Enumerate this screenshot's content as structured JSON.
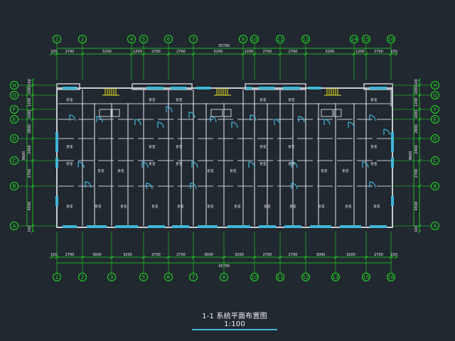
{
  "drawing": {
    "title": "1-1 系统平面布置图 1:100",
    "colors": {
      "background": "#212830",
      "wall": "#c8ccd2",
      "axis": "#20e020",
      "dimension": "#f2f2f2",
      "window": "#3fb6d9",
      "door": "#3fb6d9",
      "stair": "#e8e020",
      "room_label": "#e8e8e8"
    },
    "top_axes": [
      "1",
      "2",
      "4",
      "5",
      "6",
      "7",
      "9",
      "10",
      "11",
      "12",
      "14",
      "15",
      "16"
    ],
    "bottom_axes": [
      "1",
      "2",
      "3",
      "5",
      "6",
      "7",
      "8",
      "10",
      "11",
      "12",
      "13",
      "15",
      "16"
    ],
    "row_axes": [
      "H",
      "G",
      "F",
      "E",
      "D",
      "C",
      "B",
      "A"
    ],
    "top_dims": [
      "150",
      "2700",
      "5200",
      "1200",
      "2700",
      "2700",
      "5200",
      "1200",
      "2700",
      "2700",
      "5200",
      "1200",
      "2700",
      "150"
    ],
    "top_total": "35700",
    "bottom_dims": [
      "150",
      "2700",
      "3000",
      "3200",
      "2700",
      "2700",
      "3000",
      "3200",
      "2700",
      "2700",
      "3000",
      "3200",
      "2700",
      "150"
    ],
    "bottom_total": "35700",
    "left_dims": [
      "100",
      "1000",
      "1200",
      "1000",
      "2800",
      "2400",
      "2700",
      "4500",
      "100"
    ],
    "left_total": "9600",
    "right_dims": [
      "100",
      "1000",
      "1200",
      "1000",
      "2800",
      "2400",
      "2700",
      "4500",
      "100"
    ],
    "right_total": "9600",
    "room_label": "卧室"
  }
}
